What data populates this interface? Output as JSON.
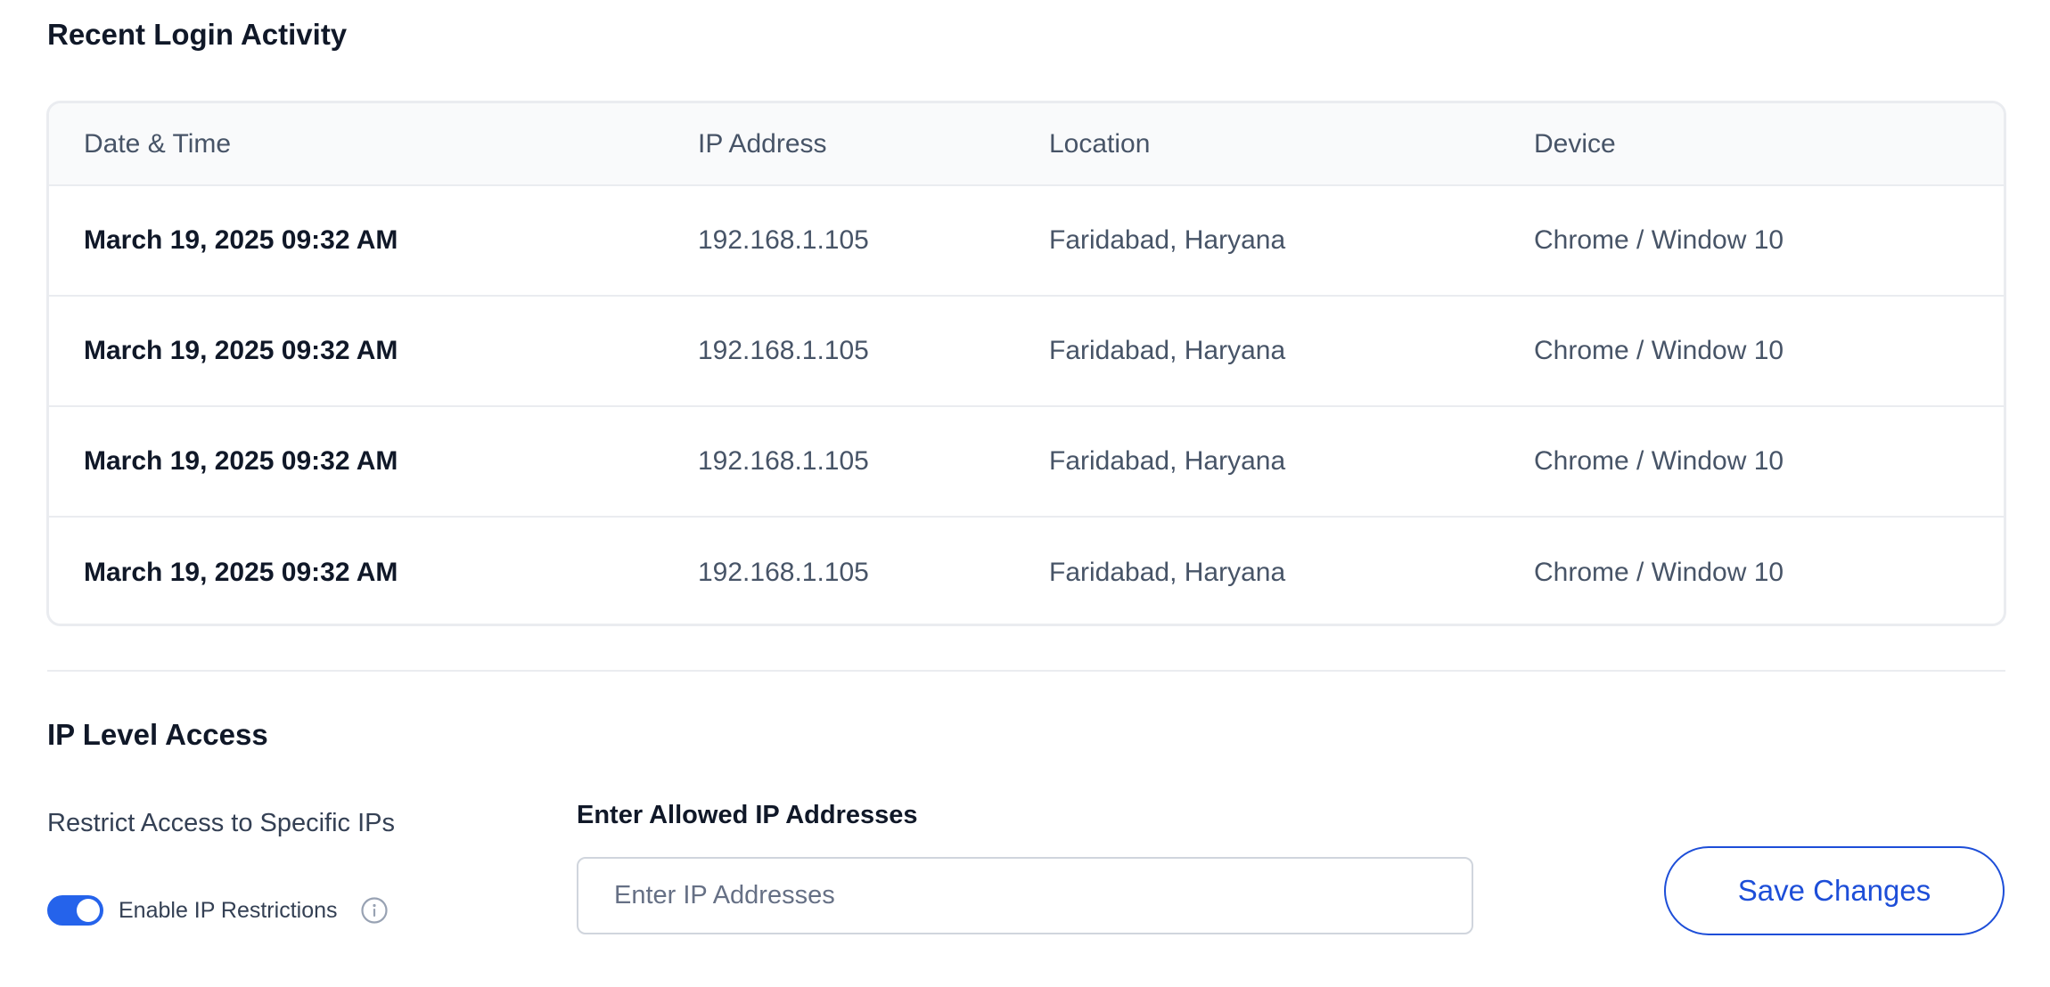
{
  "recent_login": {
    "title": "Recent Login Activity",
    "columns": [
      "Date & Time",
      "IP Address",
      "Location",
      "Device"
    ],
    "rows": [
      {
        "datetime": "March 19, 2025 09:32 AM",
        "ip": "192.168.1.105",
        "location": "Faridabad, Haryana",
        "device": "Chrome / Window 10"
      },
      {
        "datetime": "March 19, 2025 09:32 AM",
        "ip": "192.168.1.105",
        "location": "Faridabad, Haryana",
        "device": "Chrome / Window 10"
      },
      {
        "datetime": "March 19, 2025 09:32 AM",
        "ip": "192.168.1.105",
        "location": "Faridabad, Haryana",
        "device": "Chrome / Window 10"
      },
      {
        "datetime": "March 19, 2025 09:32 AM",
        "ip": "192.168.1.105",
        "location": "Faridabad, Haryana",
        "device": "Chrome / Window 10"
      }
    ]
  },
  "ip_access": {
    "title": "IP Level Access",
    "restrict_label": "Restrict Access to Specific IPs",
    "toggle_label": "Enable IP Restrictions",
    "toggle_on": true,
    "info_icon": "info-circle-icon",
    "field_label": "Enter Allowed IP Addresses",
    "input_value": "",
    "input_placeholder": "Enter IP Addresses",
    "save_label": "Save Changes"
  },
  "colors": {
    "accent": "#2563eb",
    "button_text": "#1d4ed8",
    "border": "#eaecf0",
    "header_bg": "#f9fafb"
  }
}
